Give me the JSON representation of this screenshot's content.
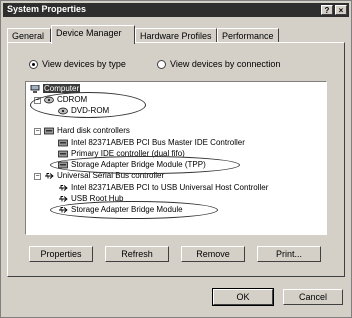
{
  "window": {
    "title": "System Properties",
    "help_glyph": "?",
    "close_glyph": "×"
  },
  "tabs": [
    {
      "label": "General"
    },
    {
      "label": "Device Manager"
    },
    {
      "label": "Hardware Profiles"
    },
    {
      "label": "Performance"
    }
  ],
  "view": {
    "by_type": "View devices by type",
    "by_connection": "View devices by connection",
    "selected": "by_type"
  },
  "tree": {
    "root": "Computer",
    "items": [
      {
        "label": "CDROM",
        "icon": "cdrom-icon",
        "expanded": true
      },
      {
        "label": "DVD-ROM",
        "icon": "cdrom-icon"
      },
      {
        "label": "Hard disk controllers",
        "icon": "controller-icon",
        "expanded": true
      },
      {
        "label": "Intel 82371AB/EB PCI Bus Master IDE Controller",
        "icon": "controller-icon"
      },
      {
        "label": "Primary IDE controller (dual fifo)",
        "icon": "controller-icon"
      },
      {
        "label": "Storage Adapter Bridge Module (TPP)",
        "icon": "controller-icon"
      },
      {
        "label": "Universal Serial Bus controller",
        "icon": "usb-icon",
        "expanded": true
      },
      {
        "label": "Intel 82371AB/EB PCI to USB Universal Host Controller",
        "icon": "usb-icon"
      },
      {
        "label": "USB Root Hub",
        "icon": "usb-icon"
      },
      {
        "label": "Storage Adapter Bridge Module",
        "icon": "usb-icon"
      }
    ]
  },
  "buttons": {
    "properties": "Properties",
    "refresh": "Refresh",
    "remove": "Remove",
    "print": "Print...",
    "ok": "OK",
    "cancel": "Cancel"
  }
}
